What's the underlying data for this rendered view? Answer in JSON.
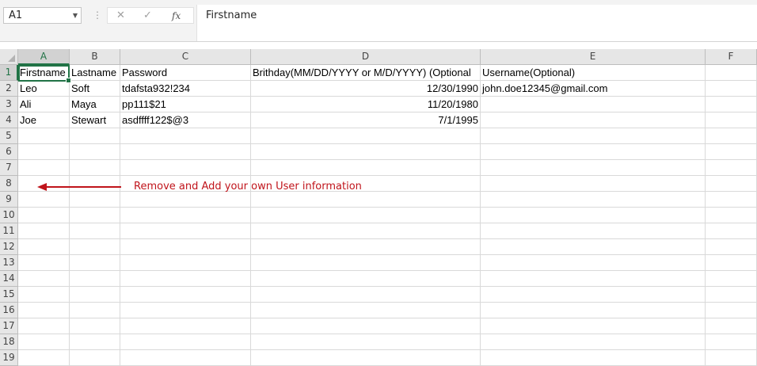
{
  "formula_bar": {
    "name_box": "A1",
    "formula": "Firstname",
    "fx_label": "fx"
  },
  "columns": [
    "A",
    "B",
    "C",
    "D",
    "E",
    "F"
  ],
  "rows": [
    "1",
    "2",
    "3",
    "4",
    "5",
    "6",
    "7",
    "8",
    "9",
    "10",
    "11",
    "12",
    "13",
    "14",
    "15",
    "16",
    "17",
    "18",
    "19"
  ],
  "cells": {
    "r1": [
      "Firstname",
      "Lastname",
      "Password",
      "Brithday(MM/DD/YYYY or M/D/YYYY) (Optional",
      "Username(Optional)",
      ""
    ],
    "r2": [
      "Leo",
      "Soft",
      "tdafsta932!234",
      "12/30/1990",
      "john.doe12345@gmail.com",
      ""
    ],
    "r3": [
      "Ali",
      "Maya",
      "pp111$21",
      "11/20/1980",
      "",
      ""
    ],
    "r4": [
      "Joe",
      "Stewart",
      "asdffff122$@3",
      "7/1/1995",
      "",
      ""
    ]
  },
  "annotation": {
    "text": "Remove and Add your own User information",
    "color": "#c0141b"
  },
  "colors": {
    "accent": "#217346"
  }
}
